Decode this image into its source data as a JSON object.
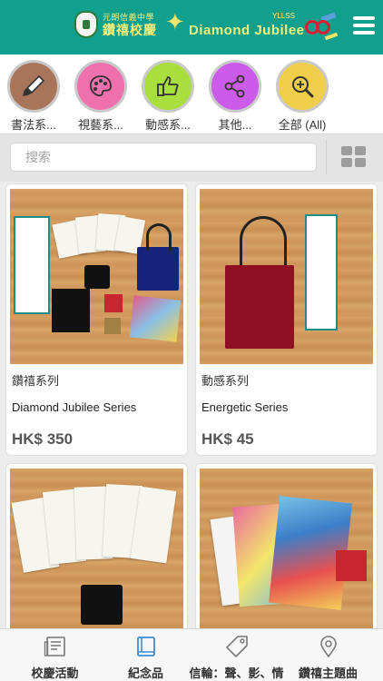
{
  "header": {
    "school_name_small": "元朗信義中學",
    "school_name_big": "鑽禧校慶",
    "jubilee_title": "Diamond Jubilee",
    "school_abbr": "YLLSS",
    "menu_icon": "hamburger-menu-icon"
  },
  "categories": [
    {
      "label": "書法系...",
      "icon": "brush-icon",
      "color": "#a9755a",
      "ring": "#d8d8d8"
    },
    {
      "label": "視藝系...",
      "icon": "palette-icon",
      "color": "#ee71ad",
      "ring": "#d8d8d8"
    },
    {
      "label": "動感系...",
      "icon": "thumbs-up-icon",
      "color": "#a9df3d",
      "ring": "#d8d8d8"
    },
    {
      "label": "其他...",
      "icon": "share-icon",
      "color": "#cc5bea",
      "ring": "#d8d8d8"
    },
    {
      "label": "全部 (All)",
      "icon": "search-icon",
      "color": "#f0ce49",
      "ring": "#d8d8d8"
    }
  ],
  "search": {
    "placeholder": "搜索",
    "value": "",
    "view_toggle_icon": "grid-view-icon"
  },
  "products": [
    {
      "series": "鑽禧系列",
      "name": "Diamond Jubilee Series",
      "price": "HK$ 350"
    },
    {
      "series": "動感系列",
      "name": "Energetic Series",
      "price": "HK$ 45"
    },
    {
      "series": "",
      "name": "",
      "price": ""
    },
    {
      "series": "",
      "name": "",
      "price": ""
    }
  ],
  "bottom_nav": [
    {
      "label": "校慶活動",
      "icon": "newspaper-icon"
    },
    {
      "label": "紀念品",
      "icon": "book-icon",
      "active": true
    },
    {
      "label": "信輪：聲、影、情",
      "icon": "tag-icon"
    },
    {
      "label": "鑽禧主題曲",
      "icon": "location-pin-icon"
    }
  ],
  "colors": {
    "header_bg": "#10a08d",
    "accent_active": "#3b8ed6",
    "banner_text": "#f4ee7a"
  }
}
